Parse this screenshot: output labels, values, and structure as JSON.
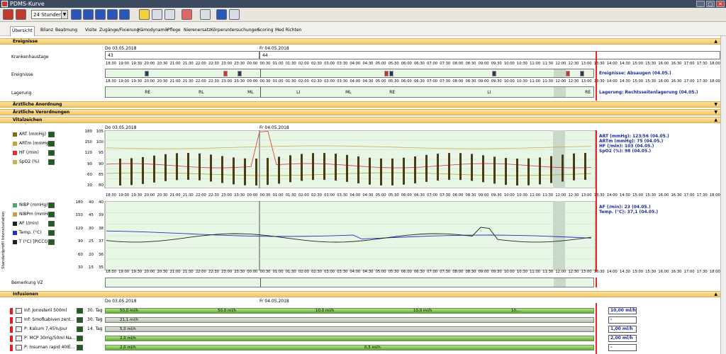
{
  "window": {
    "title": "PDMS-Kurve",
    "buttons": [
      "_",
      "□",
      "✕"
    ]
  },
  "toolbar": {
    "timespan": "24 Stunden"
  },
  "tabs": [
    "Übersicht",
    "Bilanz",
    "Beatmung",
    "Visite",
    "Zugänge/Fixierung",
    "Hämodynamik",
    "Pflege",
    "Nierenersatz",
    "Körperuntersuchungen",
    "Scoring",
    "Med Richten"
  ],
  "sections": {
    "ereignisse": "Ereignisse",
    "anordnung": "Ärztliche Anordnung",
    "verordnungen": "Ärztliche Verordnungen",
    "vitalzeichen": "Vitalzeichen",
    "infusionen": "Infusionen"
  },
  "dates": {
    "d1": "Do 03.05.2018",
    "d2": "Fr 04.05.2018"
  },
  "rows": {
    "krankenhaustage": "Krankenhaustage",
    "kh_day1": "43",
    "kh_day2": "44",
    "ereignisse": "Ereignisse",
    "lagerung": "Lagerung",
    "bemerkung": "Bemerkung VZ",
    "sidebar_vertical": "Standardprofil Intensivstation"
  },
  "times": [
    "18:30",
    "19:00",
    "19:30",
    "20:00",
    "20:30",
    "21:00",
    "21:30",
    "22:00",
    "22:30",
    "23:00",
    "23:30",
    "00:00",
    "00:30",
    "01:00",
    "01:30",
    "02:00",
    "02:30",
    "03:00",
    "03:30",
    "04:00",
    "04:30",
    "05:00",
    "05:30",
    "06:00",
    "06:30",
    "07:00",
    "07:30",
    "08:00",
    "08:30",
    "09:00",
    "09:30",
    "10:00",
    "10:30",
    "11:00",
    "11:30",
    "12:00",
    "12:30",
    "13:00",
    "13:30",
    "14:00",
    "14:30",
    "15:00",
    "15:30",
    "16:00",
    "16:30",
    "17:00",
    "17:30",
    "18:00"
  ],
  "lagerung_marks": [
    {
      "t": "RE",
      "x": 0.08
    },
    {
      "t": "RL",
      "x": 0.19
    },
    {
      "t": "ML",
      "x": 0.29
    },
    {
      "t": "LI",
      "x": 0.39
    },
    {
      "t": "ML",
      "x": 0.49
    },
    {
      "t": "RE",
      "x": 0.58
    },
    {
      "t": "LI",
      "x": 0.78
    },
    {
      "t": "RE",
      "x": 0.98
    }
  ],
  "ereignisse_right": "Ereignisse: Absaugen (04.05.)",
  "lagerung_right": "Lagerung: Rechtsseitenlagerung (04.05.)",
  "vitals1": {
    "labels": [
      "ART (mmHg)",
      "ARTm (mmHg)",
      "HF (/min)",
      "SpO2 (%)"
    ],
    "scaleA": [
      "180",
      "150",
      "120",
      "90",
      "60",
      "30"
    ],
    "scaleB": [
      "105",
      "100",
      "95",
      "90",
      "85",
      "80"
    ],
    "right": [
      "ART (mmHg): 123/56 (04.05.)",
      "ARTm (mmHg): 75 (04.05.)",
      "HF (/min): 103 (04.05.)",
      "SpO2 (%): 98 (04.05.)"
    ]
  },
  "vitals2": {
    "labels": [
      "NIBP (mmHg)",
      "NIBPm (mmHg)",
      "AF (/min)",
      "Temp. (°C)",
      "T (°C) [PICCO]"
    ],
    "scaleA": [
      "180",
      "150",
      "120",
      "90",
      "60",
      "30"
    ],
    "scaleB": [
      "40",
      "45",
      "30",
      "25",
      "20",
      "15"
    ],
    "scaleC": [
      "40",
      "39",
      "38",
      "37",
      "36",
      "35"
    ],
    "right": [
      "AF (/min): 23 (04.05.)",
      "Temp. (°C): 37,1 (04.05.)"
    ]
  },
  "infusions": [
    {
      "label": "Inf: Jonosteril 500ml",
      "day": "30. Tag",
      "rates": [
        "50,0 ml/h",
        "50,0 ml/h",
        "10,0 ml/h",
        "10,0 ml/h",
        "10,..."
      ],
      "right": "10,00 ml/h",
      "gray": false
    },
    {
      "label": "Inf: Smofkabiven zent...",
      "day": "30. Tag",
      "rates": [
        "21,1 ml/h"
      ],
      "right": "-",
      "gray": true
    },
    {
      "label": "P: Kalium 7,45%/pur",
      "day": "14. Tag",
      "rates": [
        "5,0 ml/h"
      ],
      "right": "1,00 ml/h",
      "gray": true
    },
    {
      "label": "P: MCP 30mg/50ml Na...",
      "day": "",
      "rates": [
        "2,0 ml/h"
      ],
      "right": "2,00 ml/h",
      "gray": false
    },
    {
      "label": "P: Insuman rapid 40IE...",
      "day": "",
      "rates": [
        "2,0 ml/h",
        "0,5 ml/h"
      ],
      "right": "-",
      "gray": false
    }
  ],
  "colors": {
    "art": "#7a6a1a",
    "artm": "#c0a040",
    "hf": "#e03030",
    "spo2": "#c8b050",
    "af": "#222222",
    "temp": "#2233bb",
    "accent": "#f1c769",
    "redline": "#ee2222"
  }
}
